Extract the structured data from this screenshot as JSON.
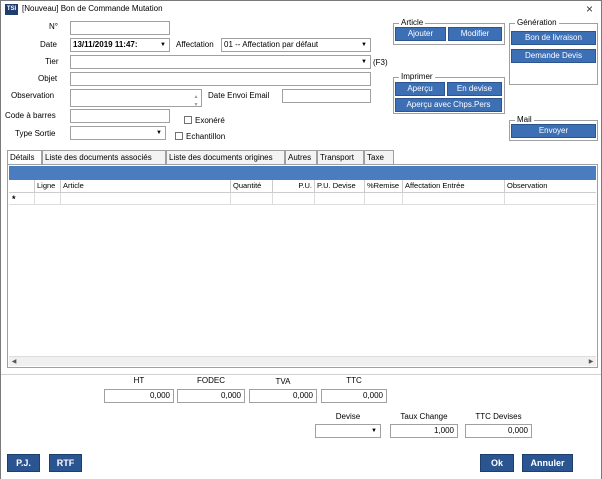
{
  "window": {
    "icon_text": "TSI",
    "title": "[Nouveau] Bon de Commande Mutation",
    "close_glyph": "×"
  },
  "form": {
    "num_label": "N°",
    "num_value": "",
    "date_label": "Date",
    "date_value": "13/11/2019 11:47:",
    "affectation_label": "Affectation",
    "affectation_value": "01 -- Affectation par défaut",
    "tier_label": "Tier",
    "tier_value": "",
    "tier_hint": "(F3)",
    "objet_label": "Objet",
    "objet_value": "",
    "observation_label": "Observation",
    "observation_value": "",
    "date_envoi_label": "Date Envoi Email",
    "date_envoi_value": "",
    "code_barres_label": "Code à barres",
    "code_barres_value": "",
    "exonere_label": "Exonéré",
    "type_sortie_label": "Type Sortie",
    "type_sortie_value": "",
    "echantillon_label": "Echantillon"
  },
  "article_group": {
    "title": "Article",
    "ajouter": "Ajouter",
    "modifier": "Modifier"
  },
  "imprimer_group": {
    "title": "Imprimer",
    "apercu": "Aperçu",
    "en_devise": "En devise",
    "apercu_chps": "Aperçu avec Chps.Pers"
  },
  "generation_group": {
    "title": "Génération",
    "bon_livraison": "Bon de livraison",
    "demande_devis": "Demande Devis"
  },
  "mail_group": {
    "title": "Mail",
    "envoyer": "Envoyer"
  },
  "tabs": [
    {
      "label": "Détails"
    },
    {
      "label": "Liste des documents associés"
    },
    {
      "label": "Liste des documents origines"
    },
    {
      "label": "Autres"
    },
    {
      "label": "Transport"
    },
    {
      "label": "Taxe"
    }
  ],
  "grid": {
    "columns": [
      "Ligne",
      "Article",
      "Quantité",
      "P.U.",
      "P.U. Devise",
      "%Remise",
      "Affectation Entrée",
      "Observation"
    ],
    "new_row_marker": "*"
  },
  "totals": {
    "ht_label": "HT",
    "ht_value": "0,000",
    "fodec_label": "FODEC",
    "fodec_value": "0,000",
    "tva_label": "TVA",
    "tva_value": "0,000",
    "ttc_label": "TTC",
    "ttc_value": "0,000",
    "devise_label": "Devise",
    "devise_value": "",
    "taux_label": "Taux Change",
    "taux_value": "1,000",
    "ttc_devises_label": "TTC Devises",
    "ttc_devises_value": "0,000"
  },
  "footer": {
    "pj": "P.J.",
    "rtf": "RTF",
    "ok": "Ok",
    "annuler": "Annuler"
  },
  "icons": {
    "dropdown": "▼",
    "spin_up": "▲",
    "spin_down": "▼",
    "scroll_left": "◀",
    "scroll_right": "▶"
  },
  "colors": {
    "accent": "#3d6fb5",
    "accent_dark": "#2b5591",
    "grid_bar": "#4a7cc0"
  }
}
